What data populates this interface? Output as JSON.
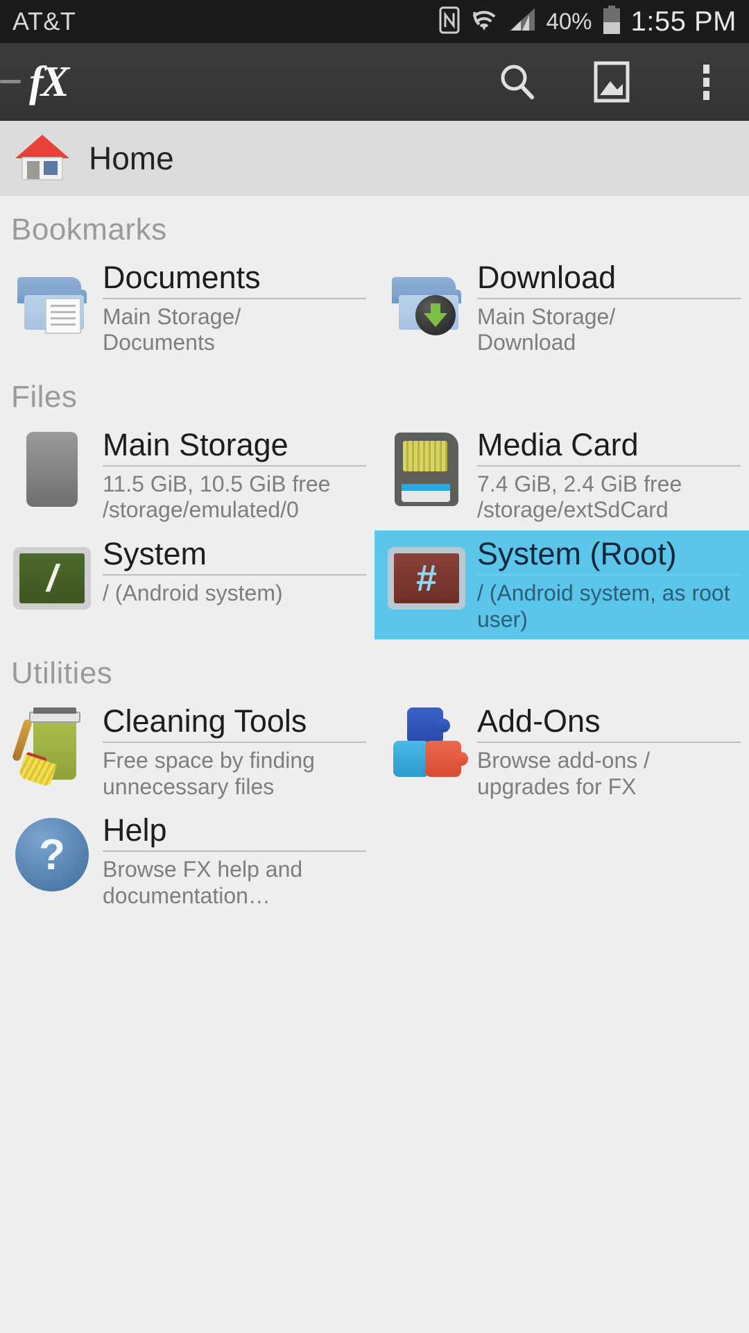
{
  "statusbar": {
    "carrier": "AT&T",
    "battery_percent": "40%",
    "clock": "1:55 PM",
    "icons": [
      "nfc-icon",
      "wifi-icon",
      "cellular-signal-icon",
      "battery-icon"
    ]
  },
  "actionbar": {
    "logo": "fX",
    "drawer_indicator": "drawer-dash-icon",
    "actions": [
      {
        "name": "search-icon",
        "label": "Search"
      },
      {
        "name": "gallery-icon",
        "label": "Gallery"
      },
      {
        "name": "overflow-menu-icon",
        "label": "More options"
      }
    ]
  },
  "breadcrumb": {
    "icon": "home-icon",
    "label": "Home"
  },
  "sections": [
    {
      "title": "Bookmarks",
      "items": [
        {
          "icon": "documents-folder-icon",
          "title": "Documents",
          "subtitle": "Main Storage/\nDocuments",
          "selected": false
        },
        {
          "icon": "download-folder-icon",
          "title": "Download",
          "subtitle": "Main Storage/\nDownload",
          "selected": false
        }
      ]
    },
    {
      "title": "Files",
      "items": [
        {
          "icon": "phone-storage-icon",
          "title": "Main Storage",
          "subtitle": "11.5 GiB, 10.5 GiB free\n/storage/emulated/0",
          "selected": false
        },
        {
          "icon": "sd-card-icon",
          "title": "Media Card",
          "subtitle": "7.4 GiB, 2.4 GiB free\n/storage/extSdCard",
          "selected": false
        },
        {
          "icon": "terminal-green-icon",
          "title": "System",
          "subtitle": "/ (Android system)",
          "selected": false
        },
        {
          "icon": "terminal-root-icon",
          "title": "System (Root)",
          "subtitle": "/ (Android system, as root user)",
          "selected": true
        }
      ]
    },
    {
      "title": "Utilities",
      "items": [
        {
          "icon": "cleaning-tools-icon",
          "title": "Cleaning Tools",
          "subtitle": "Free space by finding unnecessary files",
          "selected": false
        },
        {
          "icon": "addons-puzzle-icon",
          "title": "Add-Ons",
          "subtitle": "Browse add-ons / upgrades for FX",
          "selected": false
        },
        {
          "icon": "help-icon",
          "title": "Help",
          "subtitle": "Browse FX help and documentation…",
          "selected": false
        }
      ]
    }
  ],
  "colors": {
    "selection": "#5bc5ea",
    "statusbar_bg": "#1b1b1b",
    "actionbar_bg": "#3b3b3b",
    "breadcrumb_bg": "#dcdcdc",
    "content_bg": "#eeeeee",
    "section_title": "#9a9a9a",
    "item_subtitle": "#7e7e7e"
  }
}
